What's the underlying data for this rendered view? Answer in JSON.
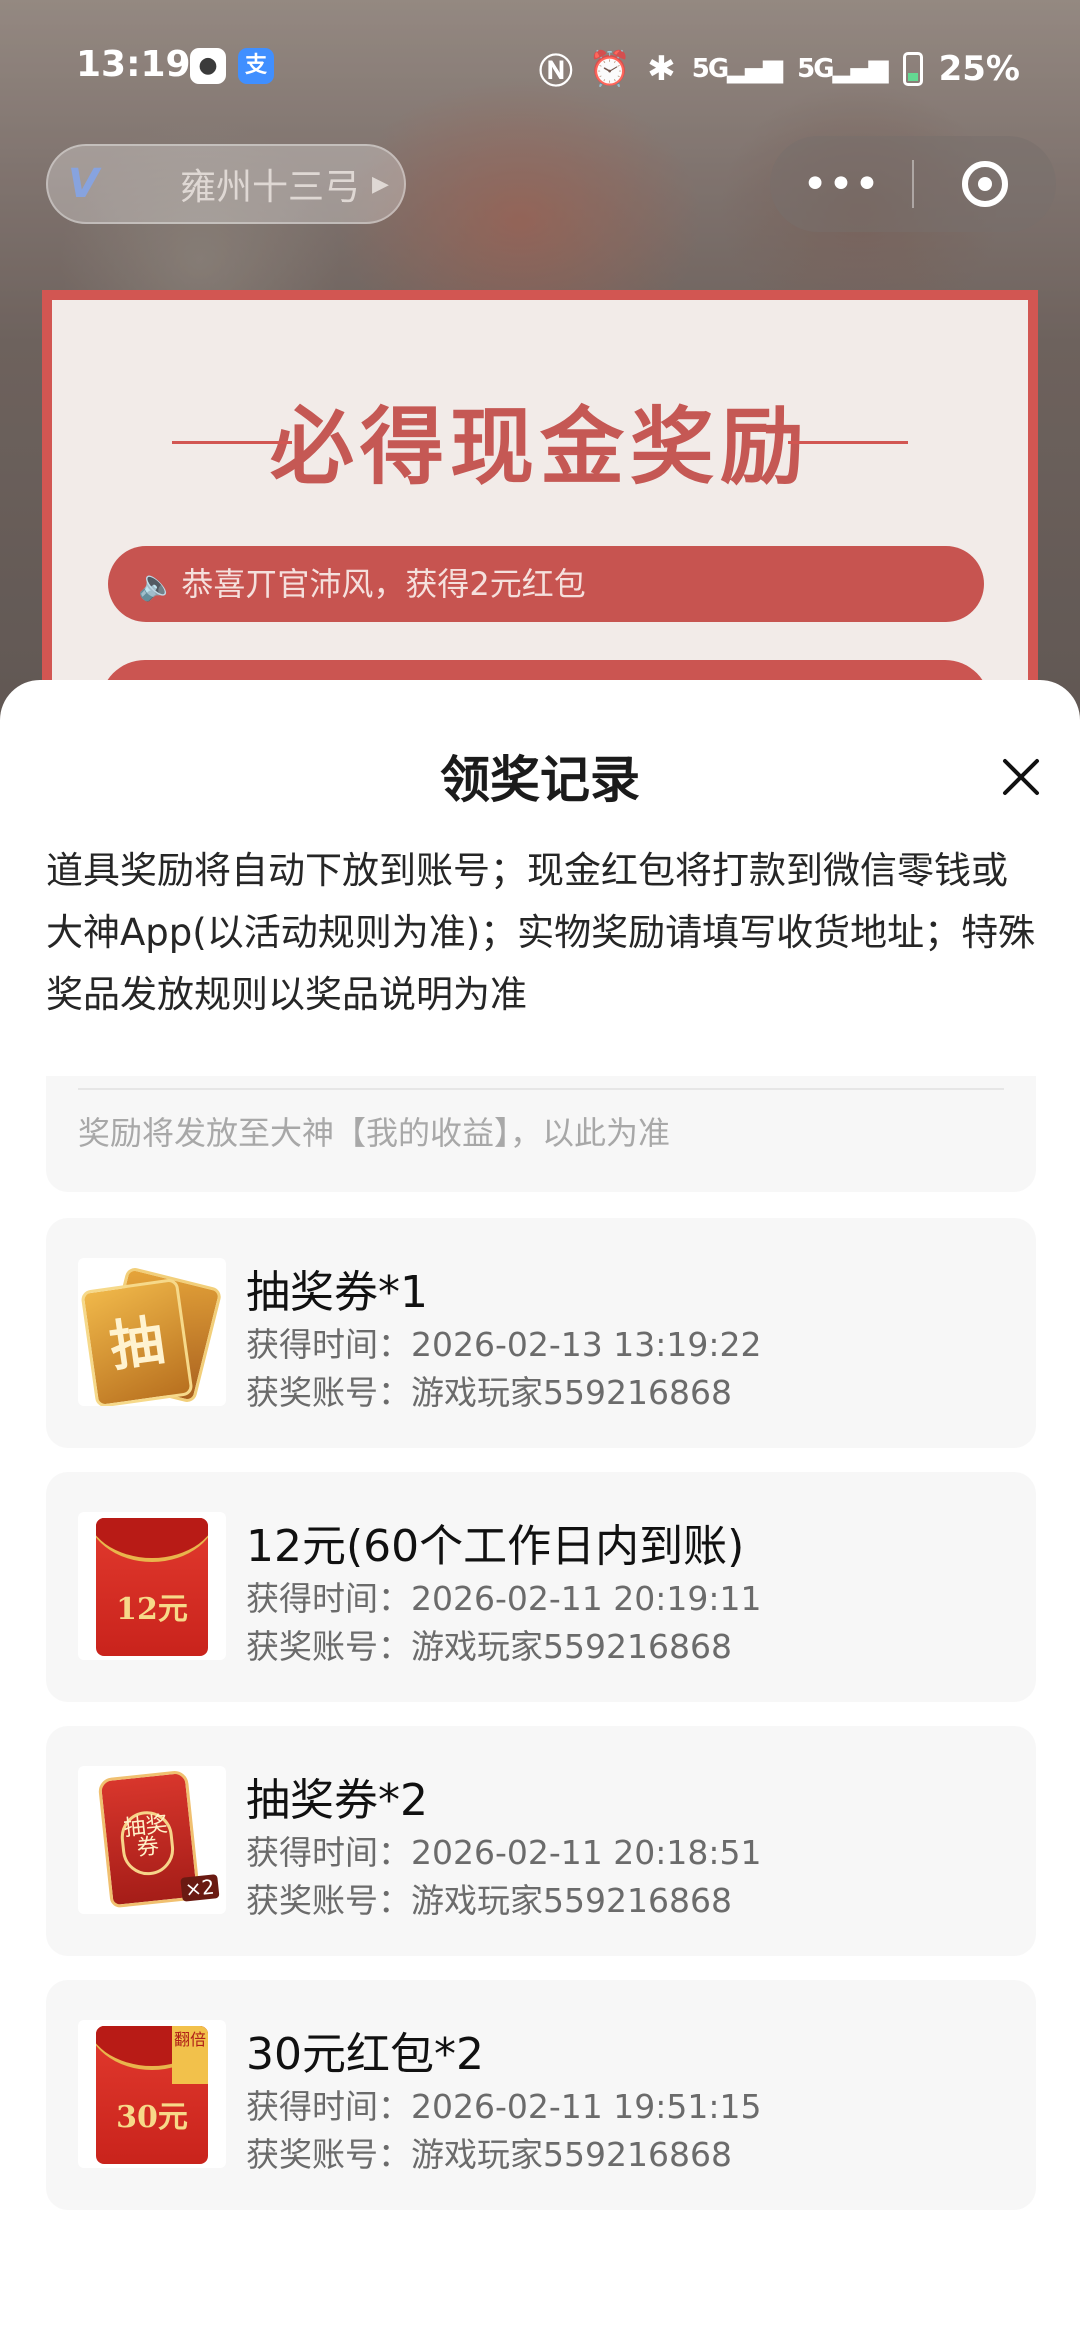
{
  "status_bar": {
    "time": "13:19",
    "app_icons": [
      "qq-icon",
      "alipay-icon"
    ],
    "signal": "5G",
    "battery": "25%"
  },
  "game": {
    "logo": "V",
    "name": "雍州十三弓"
  },
  "banner": {
    "title": "必得现金奖励",
    "notice": "恭喜丌官沛风，获得2元红包"
  },
  "sheet": {
    "title": "领奖记录",
    "notice": "道具奖励将自动下放到账号；现金红包将打款到微信零钱或大神App(以活动规则为准)；实物奖励请填写收货地址；特殊奖品发放规则以奖品说明为准",
    "partial_tip": "奖励将发放至大神【我的收益】，以此为准",
    "records": [
      {
        "name": "抽奖券*1",
        "time_label": "获得时间：",
        "time": "2026-02-13 13:19:22",
        "account_label": "获奖账号：",
        "account": "游戏玩家559216868",
        "image_text": "抽"
      },
      {
        "name": "12元(60个工作日内到账)",
        "time_label": "获得时间：",
        "time": "2026-02-11 20:19:11",
        "account_label": "获奖账号：",
        "account": "游戏玩家559216868",
        "image_text": "12元"
      },
      {
        "name": "抽奖券*2",
        "time_label": "获得时间：",
        "time": "2026-02-11 20:18:51",
        "account_label": "获奖账号：",
        "account": "游戏玩家559216868",
        "image_text": "抽奖券",
        "badge": "×2"
      },
      {
        "name": "30元红包*2",
        "time_label": "获得时间：",
        "time": "2026-02-11 19:51:15",
        "account_label": "获奖账号：",
        "account": "游戏玩家559216868",
        "image_text": "30元",
        "badge": "翻倍"
      }
    ]
  },
  "colors": {
    "accent_red": "#c9312c",
    "card_bg": "#f7f7f7",
    "secondary_text": "#6b6b6b"
  }
}
